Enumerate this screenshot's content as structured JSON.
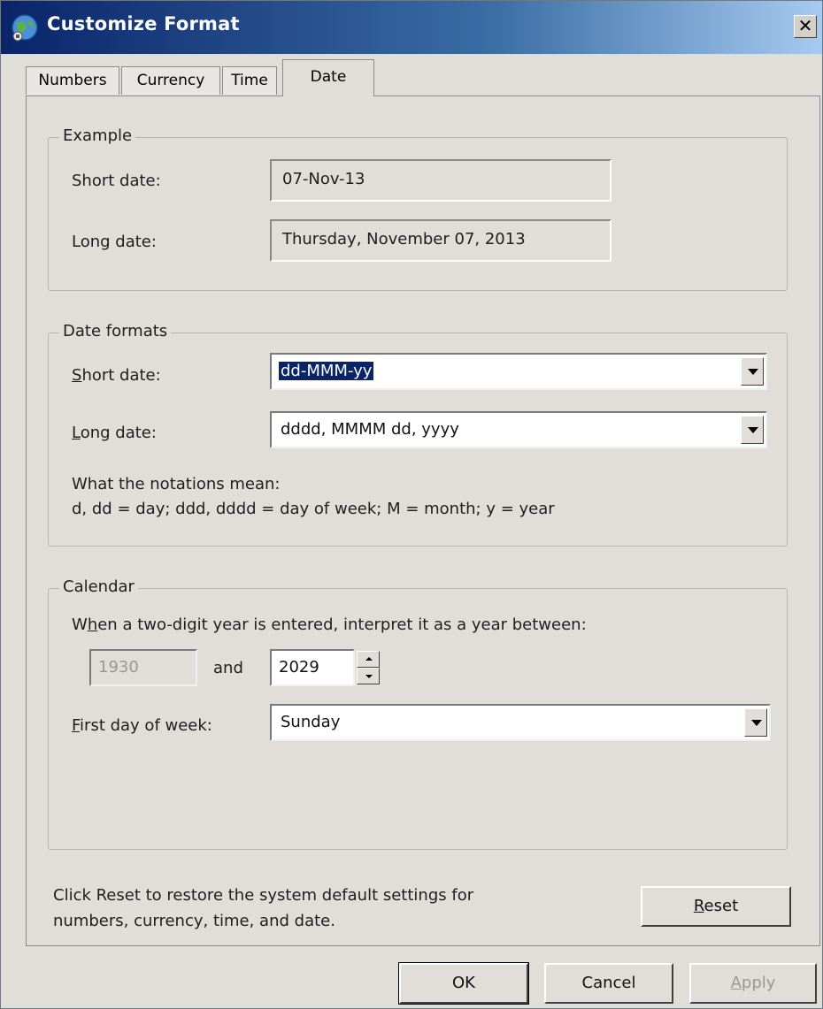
{
  "window": {
    "title": "Customize Format",
    "close_glyph": "✕"
  },
  "tabs": [
    {
      "label": "Numbers"
    },
    {
      "label": "Currency"
    },
    {
      "label": "Time"
    },
    {
      "label": "Date"
    }
  ],
  "example": {
    "legend": "Example",
    "short_label": "Short date:",
    "short_value": "07-Nov-13",
    "long_label": "Long date:",
    "long_value": "Thursday, November 07, 2013"
  },
  "date_formats": {
    "legend": "Date formats",
    "short_label_u": "S",
    "short_label_rest": "hort date:",
    "short_value": "dd-MMM-yy",
    "long_label_u": "L",
    "long_label_rest": "ong date:",
    "long_value": "dddd, MMMM dd, yyyy",
    "notes_title": "What the notations mean:",
    "notes_text": "d, dd = day;  ddd, dddd = day of week;  M = month;  y = year"
  },
  "calendar": {
    "legend": "Calendar",
    "year_prompt_pre": "W",
    "year_prompt_u": "h",
    "year_prompt_rest": "en a two-digit year is entered, interpret it as a year between:",
    "start_year": "1930",
    "and_label": "and",
    "end_year": "2029",
    "first_day_label_u": "F",
    "first_day_label_rest": "irst day of week:",
    "first_day_value": "Sunday"
  },
  "reset_info": {
    "line1": "Click Reset to restore the system default settings for",
    "line2": "numbers, currency, time, and date.",
    "button_u": "R",
    "button_rest": "eset"
  },
  "footer": {
    "ok": "OK",
    "cancel": "Cancel",
    "apply_u": "A",
    "apply_rest": "pply"
  },
  "colors": {
    "selection": "#0a246a",
    "dialog_bg": "#e1ddd9",
    "title_gradient_start": "#0a246a"
  },
  "icons": {
    "app": "globe-icon",
    "dropdown": "chevron-down-icon",
    "spin_up": "triangle-up-icon",
    "spin_down": "triangle-down-icon"
  }
}
